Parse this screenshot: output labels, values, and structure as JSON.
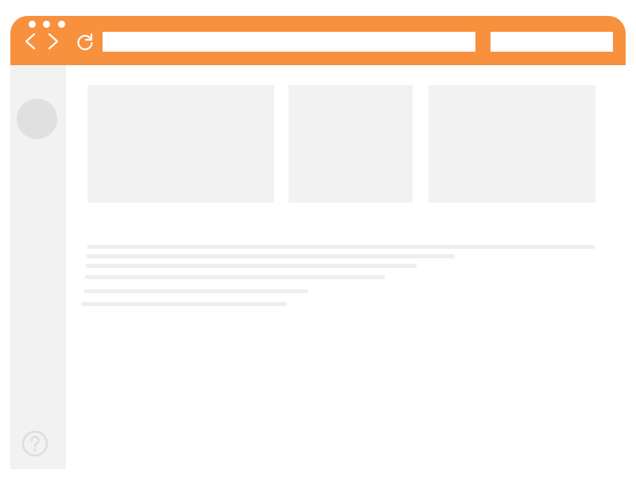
{
  "window": {
    "traffic_lights": [
      "dot",
      "dot",
      "dot"
    ]
  },
  "toolbar": {
    "color": "#f7913d",
    "back_icon": "chevron-left-icon",
    "forward_icon": "chevron-right-icon",
    "reload_icon": "reload-icon",
    "address_value": "",
    "search_value": ""
  },
  "sidebar": {
    "color": "#f2f2f2",
    "avatar_icon": "avatar",
    "help_icon": "question-circle-icon"
  },
  "main": {
    "cards": [
      "placeholder-card",
      "placeholder-card",
      "placeholder-card"
    ],
    "text_lines": [
      "placeholder-line",
      "placeholder-line",
      "placeholder-line",
      "placeholder-line",
      "placeholder-line",
      "placeholder-line"
    ],
    "placeholder_color": "#f2f2f2",
    "line_color": "#eeeeee"
  }
}
